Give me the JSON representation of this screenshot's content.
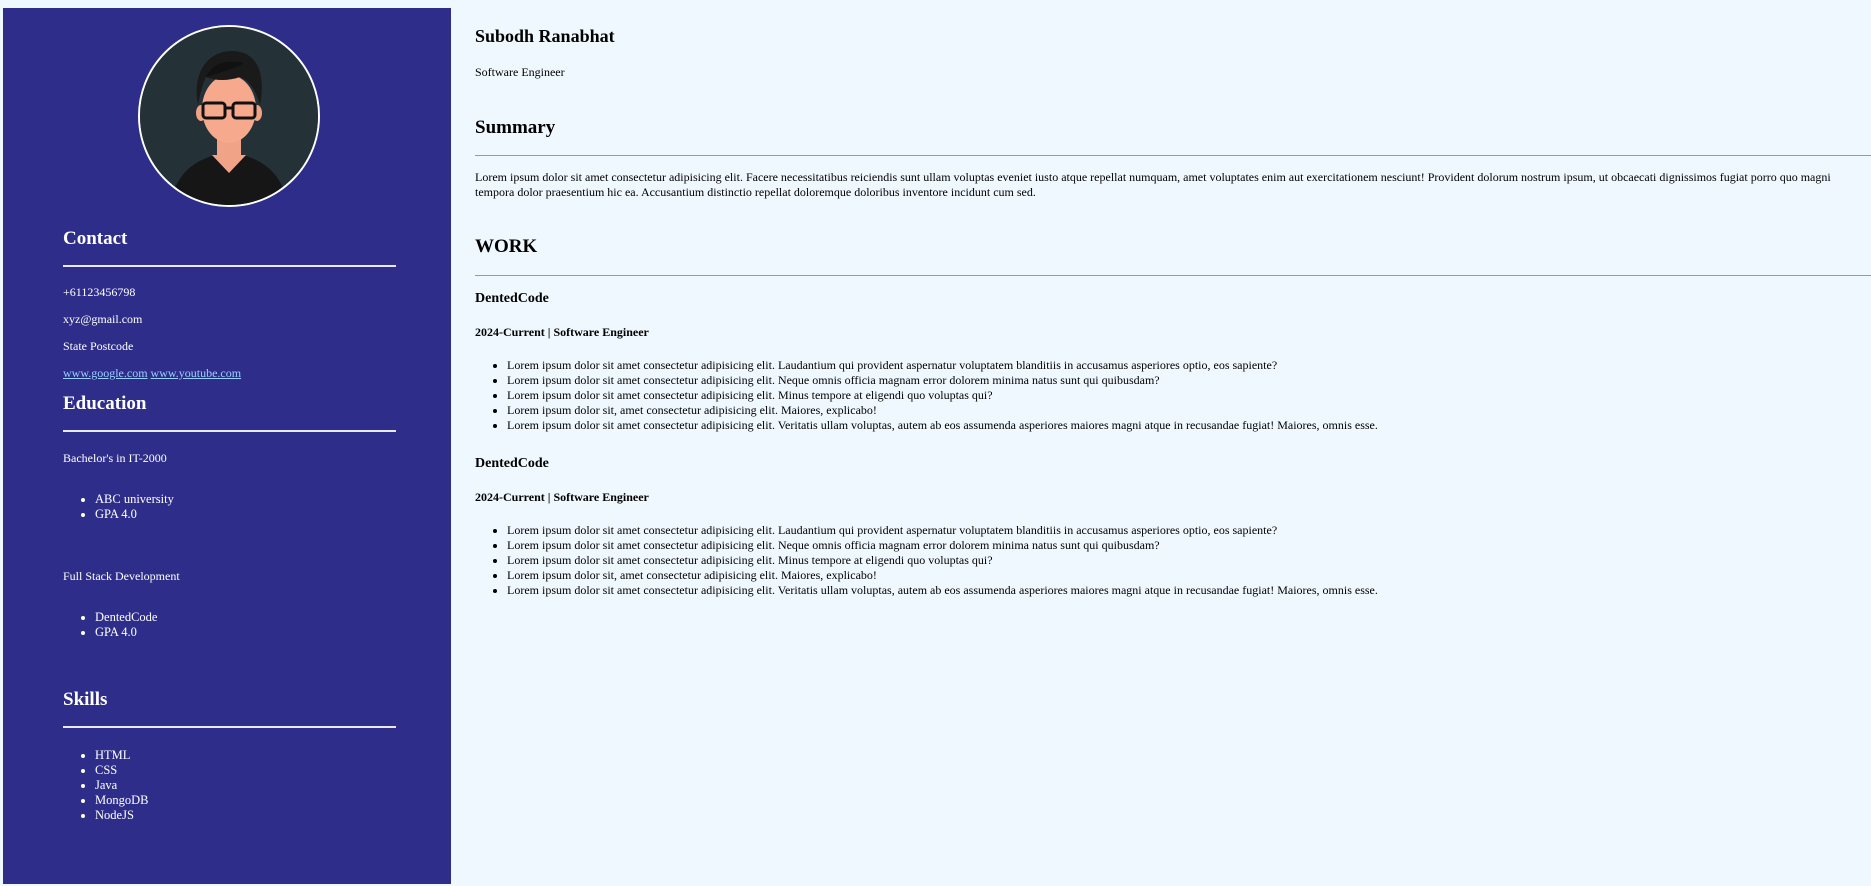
{
  "colors": {
    "sidebar_bg": "#2e2e8a",
    "page_bg": "#f0f8ff",
    "link": "#9ad0ff"
  },
  "avatar": {
    "icon": "avatar-icon"
  },
  "contact": {
    "heading": "Contact",
    "phone": "+61123456798",
    "email": "xyz@gmail.com",
    "address": "State Postcode",
    "links": [
      "www.google.com",
      "www.youtube.com"
    ]
  },
  "education": {
    "heading": "Education",
    "entries": [
      {
        "title": "Bachelor's in IT-2000",
        "items": [
          "ABC university",
          "GPA 4.0"
        ]
      },
      {
        "title": "Full Stack Development",
        "items": [
          "DentedCode",
          "GPA 4.0"
        ]
      }
    ]
  },
  "skills": {
    "heading": "Skills",
    "items": [
      "HTML",
      "CSS",
      "Java",
      "MongoDB",
      "NodeJS"
    ]
  },
  "profile": {
    "name": "Subodh Ranabhat",
    "title": "Software Engineer"
  },
  "summary": {
    "heading": "Summary",
    "text": "Lorem ipsum dolor sit amet consectetur adipisicing elit. Facere necessitatibus reiciendis sunt ullam voluptas eveniet iusto atque repellat numquam, amet voluptates enim aut exercitationem nesciunt! Provident dolorum nostrum ipsum, ut obcaecati dignissimos fugiat porro quo magni tempora dolor praesentium hic ea. Accusantium distinctio repellat doloremque doloribus inventore incidunt cum sed."
  },
  "work": {
    "heading": "WORK",
    "jobs": [
      {
        "company": "DentedCode",
        "period": "2024-Current",
        "separator": " | ",
        "role": "Software Engineer",
        "bullets": [
          "Lorem ipsum dolor sit amet consectetur adipisicing elit. Laudantium qui provident aspernatur voluptatem blanditiis in accusamus asperiores optio, eos sapiente?",
          "Lorem ipsum dolor sit amet consectetur adipisicing elit. Neque omnis officia magnam error dolorem minima natus sunt qui quibusdam?",
          "Lorem ipsum dolor sit amet consectetur adipisicing elit. Minus tempore at eligendi quo voluptas qui?",
          "Lorem ipsum dolor sit, amet consectetur adipisicing elit. Maiores, explicabo!",
          "Lorem ipsum dolor sit amet consectetur adipisicing elit. Veritatis ullam voluptas, autem ab eos assumenda asperiores maiores magni atque in recusandae fugiat! Maiores, omnis esse."
        ]
      },
      {
        "company": "DentedCode",
        "period": "2024-Current",
        "separator": " | ",
        "role": "Software Engineer",
        "bullets": [
          "Lorem ipsum dolor sit amet consectetur adipisicing elit. Laudantium qui provident aspernatur voluptatem blanditiis in accusamus asperiores optio, eos sapiente?",
          "Lorem ipsum dolor sit amet consectetur adipisicing elit. Neque omnis officia magnam error dolorem minima natus sunt qui quibusdam?",
          "Lorem ipsum dolor sit amet consectetur adipisicing elit. Minus tempore at eligendi quo voluptas qui?",
          "Lorem ipsum dolor sit, amet consectetur adipisicing elit. Maiores, explicabo!",
          "Lorem ipsum dolor sit amet consectetur adipisicing elit. Veritatis ullam voluptas, autem ab eos assumenda asperiores maiores magni atque in recusandae fugiat! Maiores, omnis esse."
        ]
      }
    ]
  }
}
